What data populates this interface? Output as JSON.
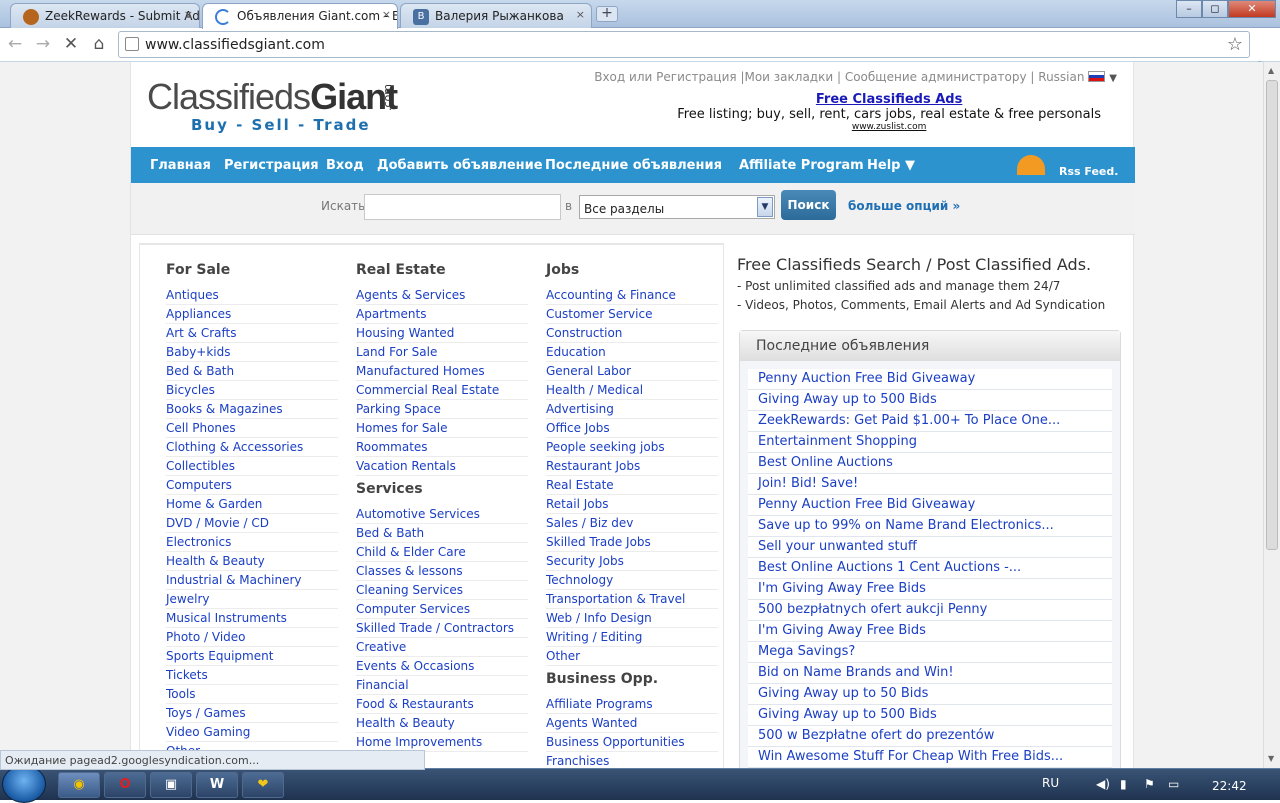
{
  "browser": {
    "tabs": [
      {
        "label": "ZeekRewards - Submit Ad fo",
        "icon": "zeek-favicon",
        "close": "×"
      },
      {
        "label": "Объявления Giant.com - B",
        "icon": "loading-spinner",
        "close": "×"
      },
      {
        "label": "Валерия Рыжанкова",
        "icon": "vk-favicon",
        "close": "×"
      }
    ],
    "new_tab": "+",
    "window_buttons": [
      "–",
      "◻",
      "✕"
    ],
    "url": "www.classifiedsgiant.com",
    "nav": {
      "back": "←",
      "forward": "→",
      "stop": "✕",
      "home": "⌂",
      "star": "☆",
      "wrench": "🔧"
    }
  },
  "site": {
    "logo_main": "Classifieds",
    "logo_bold": "Giant",
    "logo_com": ".com",
    "logo_tagline": "Buy - Sell - Trade",
    "top_links": {
      "login": "Вход",
      "or": "или",
      "register": "Регистрация",
      "bookmarks": "|Мои закладки",
      "message_admin": "| Сообщение администратору",
      "language": "| Russian",
      "caret": "▼"
    },
    "promo": {
      "link": "Free Classifieds Ads",
      "text": "Free listing; buy, sell, rent, cars jobs, real estate & free personals",
      "site": "www.zuslist.com"
    },
    "menu": [
      "Главная",
      "Регистрация",
      "Вход",
      "Добавить объявление",
      "Последние объявления",
      "Affiliate Program",
      "Help ▼"
    ],
    "rss": "Rss Feed.",
    "search": {
      "label": "Искать",
      "in_label": "в",
      "query": "",
      "category_value": "Все разделы",
      "button": "Поиск",
      "more": "больше опций »"
    }
  },
  "categories": {
    "col1": [
      {
        "title": "For Sale",
        "items": [
          "Antiques",
          "Appliances",
          "Art & Crafts",
          "Baby+kids",
          "Bed & Bath",
          "Bicycles",
          "Books & Magazines",
          "Cell Phones",
          "Clothing & Accessories",
          "Collectibles",
          "Computers",
          "Home & Garden",
          "DVD / Movie / CD",
          "Electronics",
          "Health & Beauty",
          "Industrial & Machinery",
          "Jewelry",
          "Musical Instruments",
          "Photo / Video",
          "Sports Equipment",
          "Tickets",
          "Tools",
          "Toys / Games",
          "Video Gaming",
          "Other"
        ]
      }
    ],
    "col2": [
      {
        "title": "Real Estate",
        "items": [
          "Agents & Services",
          "Apartments",
          "Housing Wanted",
          "Land For Sale",
          "Manufactured Homes",
          "Commercial Real Estate",
          "Parking Space",
          "Homes for Sale",
          "Roommates",
          "Vacation Rentals"
        ]
      },
      {
        "title": "Services",
        "items": [
          "Automotive Services",
          "Bed & Bath",
          "Child & Elder Care",
          "Classes & lessons",
          "Cleaning Services",
          "Computer Services",
          "Skilled Trade / Contractors",
          "Creative",
          "Events & Occasions",
          "Financial",
          "Food & Restaurants",
          "Health & Beauty",
          "Home Improvements"
        ]
      }
    ],
    "col3": [
      {
        "title": "Jobs",
        "items": [
          "Accounting & Finance",
          "Customer Service",
          "Construction",
          "Education",
          "General Labor",
          "Health / Medical",
          "Advertising",
          "Office Jobs",
          "People seeking jobs",
          "Restaurant Jobs",
          "Real Estate",
          "Retail Jobs",
          "Sales / Biz dev",
          "Skilled Trade Jobs",
          "Security Jobs",
          "Technology",
          "Transportation & Travel",
          "Web / Info Design",
          "Writing / Editing",
          "Other"
        ]
      },
      {
        "title": "Business Opp.",
        "items": [
          "Affiliate Programs",
          "Agents Wanted",
          "Business Opportunities",
          "Franchises"
        ]
      }
    ]
  },
  "sidebar": {
    "heading": "Free Classifieds Search / Post Classified Ads.",
    "bullets": [
      "- Post unlimited classified ads and manage them 24/7",
      "- Videos, Photos, Comments, Email Alerts and Ad Syndication"
    ],
    "latest_title": "Последние объявления",
    "latest": [
      "Penny Auction Free Bid Giveaway",
      "Giving Away up to 500 Bids",
      "ZeekRewards: Get Paid $1.00+ To Place One...",
      "Entertainment Shopping",
      "Best Online Auctions",
      "Join! Bid! Save!",
      "Penny Auction Free Bid Giveaway",
      "Save up to 99% on Name Brand Electronics...",
      "Sell your unwanted stuff",
      "Best Online Auctions 1 Cent Auctions -...",
      "I'm Giving Away Free Bids",
      "500 bezpłatnych ofert aukcji Penny",
      "I'm Giving Away Free Bids",
      "Mega Savings?",
      "Bid on Name Brands and Win!",
      "Giving Away up to 50 Bids",
      "Giving Away up to 500 Bids",
      "500 w Bezpłatne ofert do prezentów",
      "Win Awesome Stuff For Cheap With Free Bids..."
    ]
  },
  "status_text": "Ожидание pagead2.googlesyndication.com...",
  "taskbar": {
    "lang": "RU",
    "time": "22:42",
    "apps": [
      "chrome",
      "opera",
      "save",
      "word",
      "winamp"
    ],
    "app_glyphs": [
      "◉",
      "O",
      "▣",
      "W",
      "❤"
    ]
  },
  "colors": {
    "accent": "#2c93cf",
    "link": "#1a3ec4",
    "brand_blue": "#1d6fae"
  }
}
